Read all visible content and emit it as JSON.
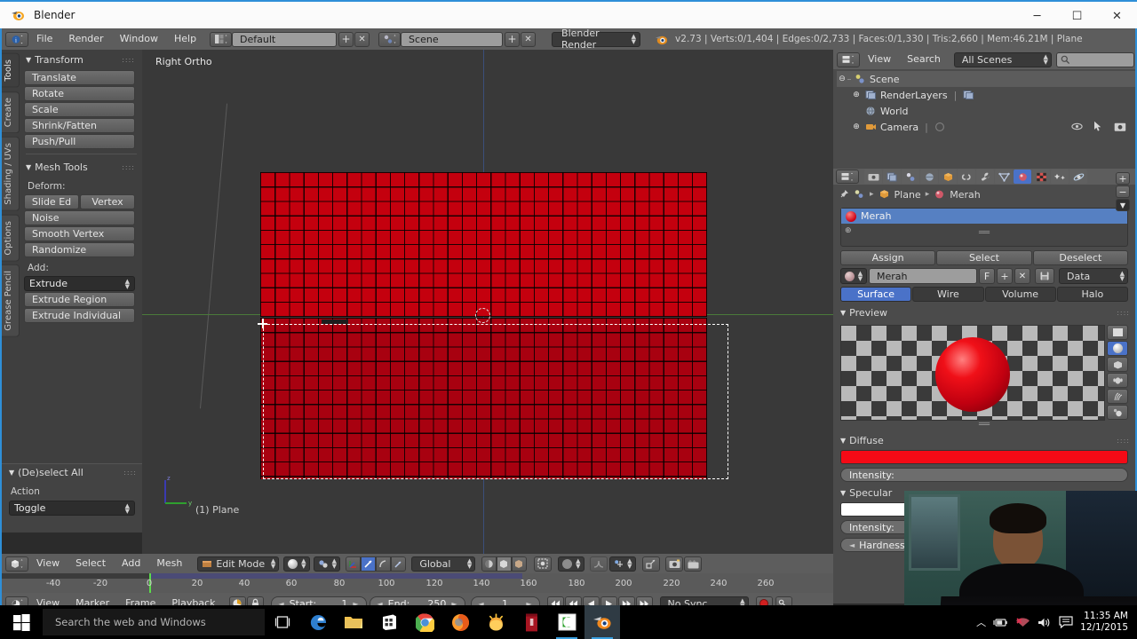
{
  "window": {
    "title": "Blender",
    "app_icon": "blender-logo-icon",
    "minimize": "─",
    "maximize": "☐",
    "close": "✕"
  },
  "info_header": {
    "editor_icon": "info-editor-icon",
    "menus": [
      "File",
      "Render",
      "Window",
      "Help"
    ],
    "screen_layout_icon": "screen-layout-icon",
    "screen_layout": "Default",
    "add_screen": "+",
    "delete_screen": "✕",
    "scene_icon": "scene-icon",
    "scene": "Scene",
    "add_scene": "+",
    "delete_scene": "✕",
    "render_engine": "Blender Render",
    "blender_icon": "blender-logo-icon",
    "stats": "v2.73 | Verts:0/1,404 | Edges:0/2,733 | Faces:0/1,330 | Tris:2,660 | Mem:46.21M | Plane"
  },
  "toolshelf": {
    "tabs": [
      {
        "label": "Tools",
        "active": true
      },
      {
        "label": "Create",
        "active": false
      },
      {
        "label": "Shading / UVs",
        "active": false
      },
      {
        "label": "Options",
        "active": false
      },
      {
        "label": "Grease Pencil",
        "active": false
      }
    ],
    "panels": [
      {
        "title": "Transform",
        "buttons": [
          "Translate",
          "Rotate",
          "Scale",
          "Shrink/Fatten",
          "Push/Pull"
        ]
      },
      {
        "title": "Mesh Tools",
        "deform_label": "Deform:",
        "deform_pair": [
          "Slide Ed",
          "Vertex"
        ],
        "deform_buttons": [
          "Noise",
          "Smooth Vertex",
          "Randomize"
        ],
        "add_label": "Add:",
        "add_dropdown": "Extrude",
        "add_buttons": [
          "Extrude Region",
          "Extrude Individual"
        ]
      }
    ],
    "operator_panel": {
      "title": "(De)select All",
      "action_label": "Action",
      "action_value": "Toggle"
    }
  },
  "viewport": {
    "view_name": "Right Ortho",
    "object_info": "(1) Plane",
    "axis_z": "z",
    "axis_y": "y",
    "header": {
      "editor_icon": "3d-view-editor-icon",
      "menus": [
        "View",
        "Select",
        "Add",
        "Mesh"
      ],
      "mode_icon": "edit-mode-icon",
      "mode": "Edit Mode",
      "viewport_shading_icon": "shading-solid-icon",
      "shading_mode_icon": "shading-mode-icon",
      "select_modes": [
        "vertex-select-icon",
        "edge-select-icon",
        "face-select-icon"
      ],
      "pivot_icon": "pivot-icon",
      "transform_orientation": "Global",
      "occlude_icons": [
        "limit-selection-icon",
        "occlude-geometry-icon",
        "texture-solid-icon"
      ],
      "snap_icon": "snap-magnet-icon",
      "proportional_icon": "proportional-edit-icon",
      "proportional_falloff_icon": "falloff-smooth-icon",
      "manipulator_icons": [
        "manipulator-icon",
        "render-icon",
        "render-animation-icon"
      ]
    }
  },
  "timeline": {
    "ticks": [
      "-40",
      "-20",
      "0",
      "20",
      "40",
      "60",
      "80",
      "100",
      "120",
      "140",
      "160",
      "180",
      "200",
      "220",
      "240",
      "260"
    ],
    "editor_icon": "timeline-editor-icon",
    "menus": [
      "View",
      "Marker",
      "Frame",
      "Playback"
    ],
    "use_preview_icon": "preview-range-icon",
    "lock_icon": "lock-icon",
    "start_label": "Start:",
    "start_value": "1",
    "end_label": "End:",
    "end_value": "250",
    "current_frame": "1",
    "transport": [
      "jump-to-start-icon",
      "step-back-icon",
      "play-reverse-icon",
      "play-icon",
      "step-forward-icon",
      "jump-to-end-icon"
    ],
    "sync_mode": "No Sync",
    "record_icon": "record-icon",
    "keying_icon": "keying-set-icon"
  },
  "outliner": {
    "editor_icon": "outliner-editor-icon",
    "menus": [
      "View",
      "Search"
    ],
    "display_mode": "All Scenes",
    "search_icon": "search-icon",
    "search_value": "",
    "rows": [
      {
        "label": "Scene",
        "icon": "scene-icon",
        "depth": 0,
        "selected": true,
        "expander": "⊖"
      },
      {
        "label": "RenderLayers",
        "icon": "renderlayers-icon",
        "depth": 1,
        "selected": false,
        "expander": "⊕"
      },
      {
        "label": "World",
        "icon": "world-icon",
        "depth": 1,
        "selected": false,
        "expander": ""
      },
      {
        "label": "Camera",
        "icon": "camera-icon",
        "depth": 1,
        "selected": false,
        "expander": "⊕"
      }
    ],
    "restrict_icons": [
      "restrict-view-icon",
      "restrict-select-icon",
      "restrict-render-icon"
    ]
  },
  "properties": {
    "tabs": [
      {
        "name": "render-tab",
        "icon": "camera-back-icon",
        "active": false
      },
      {
        "name": "render-layers-tab",
        "icon": "render-layers-icon",
        "active": false
      },
      {
        "name": "scene-tab",
        "icon": "scene-tab-icon",
        "active": false
      },
      {
        "name": "world-tab",
        "icon": "world-tab-icon",
        "active": false
      },
      {
        "name": "object-tab",
        "icon": "object-cube-icon",
        "active": false
      },
      {
        "name": "constraints-tab",
        "icon": "chain-icon",
        "active": false
      },
      {
        "name": "modifiers-tab",
        "icon": "wrench-icon",
        "active": false
      },
      {
        "name": "data-tab",
        "icon": "mesh-data-icon",
        "active": false
      },
      {
        "name": "material-tab",
        "icon": "material-sphere-icon",
        "active": true
      },
      {
        "name": "texture-tab",
        "icon": "checker-texture-icon",
        "active": false
      },
      {
        "name": "particles-tab",
        "icon": "particles-icon",
        "active": false
      },
      {
        "name": "physics-tab",
        "icon": "physics-icon",
        "active": false
      }
    ],
    "breadcrumb": {
      "pin_icon": "pin-icon",
      "root_icon": "scene-icon",
      "object_icon": "object-cube-icon",
      "object": "Plane",
      "material_icon": "material-sphere-icon",
      "material": "Merah"
    },
    "material_slots": [
      {
        "name": "Merah",
        "icon": "material-sphere-icon",
        "selected": true
      }
    ],
    "slot_buttons": [
      "+",
      "−",
      "▼"
    ],
    "assign_row": [
      "Assign",
      "Select",
      "Deselect"
    ],
    "material_datablock": {
      "browse_icon": "material-browse-icon",
      "name": "Merah",
      "fake_user": "F",
      "new": "+",
      "unlink": "✕",
      "copy_icon": "copy-icon",
      "link": "Data"
    },
    "shading_tabs": [
      {
        "label": "Surface",
        "active": true
      },
      {
        "label": "Wire",
        "active": false
      },
      {
        "label": "Volume",
        "active": false
      },
      {
        "label": "Halo",
        "active": false
      }
    ],
    "preview": {
      "title": "Preview",
      "type_buttons": [
        "preview-flat-icon",
        "preview-sphere-icon",
        "preview-cube-icon",
        "preview-monkey-icon",
        "preview-hair-icon",
        "preview-sphere-sky-icon"
      ],
      "active_type": "preview-sphere-icon"
    },
    "diffuse": {
      "title": "Diffuse",
      "color": "#f40a16",
      "intensity_label": "Intensity:"
    },
    "specular": {
      "title": "Specular",
      "color": "#ffffff",
      "intensity_label": "Intensity:",
      "hardness_label": "Hardness:"
    }
  },
  "webcam": {
    "label": "webcam-overlay"
  },
  "taskbar": {
    "start_icon": "windows-start-icon",
    "search_placeholder": "Search the web and Windows",
    "task_view_icon": "task-view-icon",
    "apps": [
      {
        "name": "edge",
        "icon": "edge-icon"
      },
      {
        "name": "file-explorer",
        "icon": "folder-icon"
      },
      {
        "name": "store",
        "icon": "store-icon"
      },
      {
        "name": "chrome",
        "icon": "chrome-icon"
      },
      {
        "name": "firefox",
        "icon": "firefox-icon"
      },
      {
        "name": "sunset-app",
        "icon": "sunset-icon"
      },
      {
        "name": "red-app",
        "icon": "red-book-icon"
      },
      {
        "name": "camtasia",
        "icon": "camtasia-icon"
      },
      {
        "name": "blender",
        "icon": "blender-logo-icon"
      }
    ],
    "tray": [
      "show-hidden-icon",
      "battery-icon",
      "network-icon",
      "volume-icon",
      "action-center-icon"
    ],
    "time": "11:35 AM",
    "date": "12/1/2015"
  },
  "colors": {
    "accent_blue": "#4a72c8",
    "header_gray": "#5d5d5d",
    "panel_gray": "#4b4b4b",
    "plane_red": "#c4000e"
  }
}
